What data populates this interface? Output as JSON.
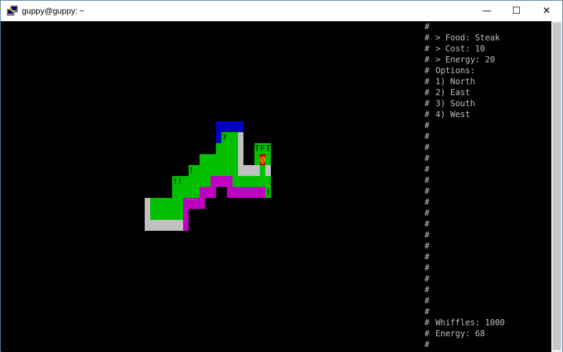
{
  "window": {
    "title": "guppy@guppy: ~",
    "controls": {
      "minimize": "—",
      "maximize": "☐",
      "close": "✕"
    }
  },
  "sidebar": {
    "wall_char": "#",
    "food_line": "> Food: Steak",
    "cost_line": "> Cost: 10",
    "energy_line": "> Energy: 20",
    "options_header": "Options:",
    "options": [
      "1) North",
      "2) East",
      "3) South",
      "4) West"
    ],
    "whiffles_line": "Whiffles: 1000",
    "energy_status_line": "Energy: 68"
  },
  "map": {
    "colors": {
      "grass": "#00c000",
      "wall": "#c0c0c0",
      "water": "#0000c0",
      "mud": "#c000c0",
      "player": "#c00000",
      "player_glyph": "#ffff00"
    },
    "glyphs": {
      "player": "@",
      "tree1": "T",
      "food": "F",
      "tree2": "T",
      "unknown": "?",
      "item1": "!",
      "item2": "!!",
      "item3": "!"
    }
  }
}
